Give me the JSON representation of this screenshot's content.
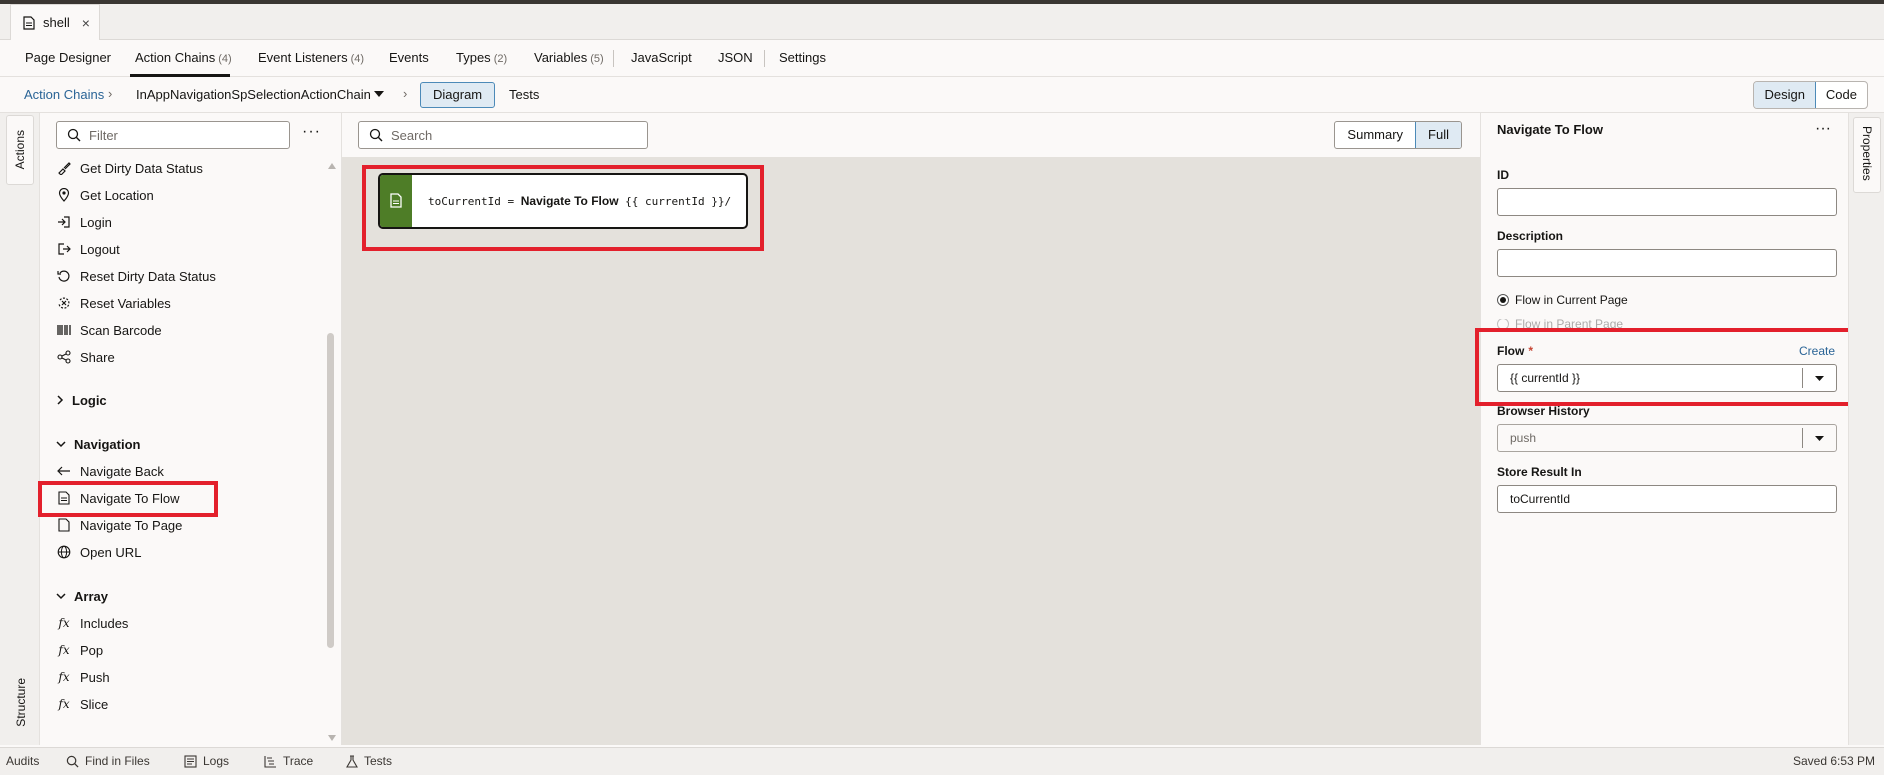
{
  "file_tab": {
    "title": "shell",
    "close": "×"
  },
  "editor_tabs": [
    {
      "label": "Page Designer",
      "count": ""
    },
    {
      "label": "Action Chains",
      "count": "(4)"
    },
    {
      "label": "Event Listeners",
      "count": "(4)"
    },
    {
      "label": "Events",
      "count": ""
    },
    {
      "label": "Types",
      "count": "(2)"
    },
    {
      "label": "Variables",
      "count": "(5)"
    },
    {
      "label": "JavaScript",
      "count": ""
    },
    {
      "label": "JSON",
      "count": ""
    },
    {
      "label": "Settings",
      "count": ""
    }
  ],
  "breadcrumb": {
    "root": "Action Chains",
    "current": "InAppNavigationSpSelectionActionChain",
    "diagram": "Diagram",
    "tests": "Tests"
  },
  "view_toggle": {
    "design": "Design",
    "code": "Code"
  },
  "left_rail": {
    "actions": "Actions",
    "structure": "Structure"
  },
  "palette": {
    "filter_placeholder": "Filter",
    "more": "···",
    "items_top": [
      {
        "label": "Get Dirty Data Status",
        "icon": "brush-icon"
      },
      {
        "label": "Get Location",
        "icon": "location-pin-icon"
      },
      {
        "label": "Login",
        "icon": "login-icon"
      },
      {
        "label": "Logout",
        "icon": "logout-icon"
      },
      {
        "label": "Reset Dirty Data Status",
        "icon": "reset-icon"
      },
      {
        "label": "Reset Variables",
        "icon": "reset-variables-icon"
      },
      {
        "label": "Scan Barcode",
        "icon": "barcode-icon"
      },
      {
        "label": "Share",
        "icon": "share-icon"
      }
    ],
    "logic_section": "Logic",
    "navigation_section": "Navigation",
    "navigation_items": [
      {
        "label": "Navigate Back",
        "icon": "arrow-left-icon"
      },
      {
        "label": "Navigate To Flow",
        "icon": "flow-doc-icon"
      },
      {
        "label": "Navigate To Page",
        "icon": "page-icon"
      },
      {
        "label": "Open URL",
        "icon": "globe-icon"
      }
    ],
    "array_section": "Array",
    "array_items": [
      {
        "label": "Includes",
        "icon": "fx-icon"
      },
      {
        "label": "Pop",
        "icon": "fx-icon"
      },
      {
        "label": "Push",
        "icon": "fx-icon"
      },
      {
        "label": "Slice",
        "icon": "fx-icon"
      }
    ]
  },
  "canvas": {
    "search_placeholder": "Search",
    "summary": "Summary",
    "full": "Full",
    "node": {
      "target": "toCurrentId",
      "equals": "=",
      "action": "Navigate To Flow",
      "arg": "{{ currentId }}/"
    }
  },
  "properties": {
    "title": "Navigate To Flow",
    "more": "···",
    "id_label": "ID",
    "id_value": "",
    "description_label": "Description",
    "description_value": "",
    "radio_current": "Flow in Current Page",
    "radio_parent": "Flow in Parent Page",
    "flow_label": "Flow",
    "flow_required": "*",
    "create": "Create",
    "flow_value": "{{ currentId }}",
    "browser_history_label": "Browser History",
    "browser_history_value": "push",
    "store_result_label": "Store Result In",
    "store_result_value": "toCurrentId",
    "rail_tab": "Properties"
  },
  "status_bar": {
    "audits": "Audits",
    "find": "Find in Files",
    "logs": "Logs",
    "trace": "Trace",
    "tests": "Tests",
    "saved": "Saved 6:53 PM"
  },
  "colors": {
    "accent": "#4c8ab8",
    "highlight": "#e3202c",
    "node_green": "#4e7d27"
  }
}
